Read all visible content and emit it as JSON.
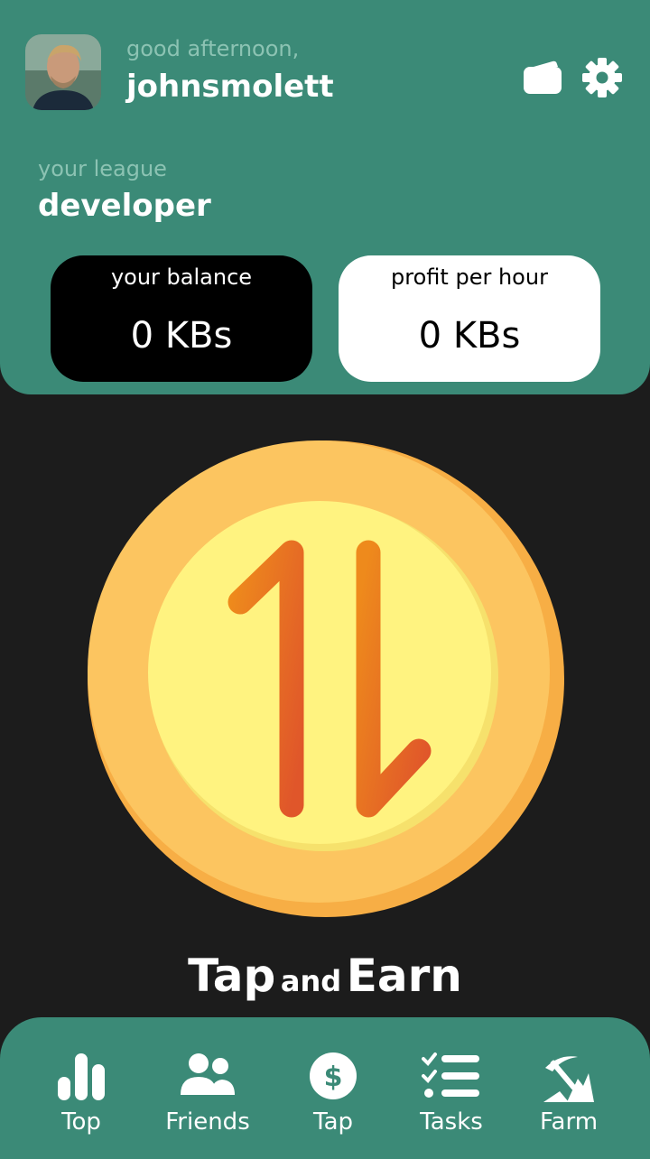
{
  "header": {
    "greeting": "good afternoon,",
    "username": "johnsmolett",
    "league_label": "your league",
    "league_value": "developer"
  },
  "icons": {
    "avatar": "user-avatar-photo",
    "wallet": "wallet-icon",
    "settings": "gear-icon"
  },
  "cards": {
    "balance": {
      "label": "your balance",
      "value": "0 KBs"
    },
    "profit": {
      "label": "profit per hour",
      "value": "0 KBs"
    }
  },
  "tap": {
    "big1": "Tap",
    "small": "and",
    "big2": "Earn"
  },
  "nav": {
    "items": [
      {
        "label": "Top",
        "icon": "bar-chart-icon"
      },
      {
        "label": "Friends",
        "icon": "people-icon"
      },
      {
        "label": "Tap",
        "icon": "dollar-coin-icon"
      },
      {
        "label": "Tasks",
        "icon": "checklist-icon"
      },
      {
        "label": "Farm",
        "icon": "pickaxe-icon"
      }
    ]
  },
  "colors": {
    "primary": "#3b8a77",
    "background": "#1c1c1c",
    "coin_outer": "#fbbf4f",
    "coin_inner": "#fff27f",
    "arrows": "#e8701f"
  }
}
